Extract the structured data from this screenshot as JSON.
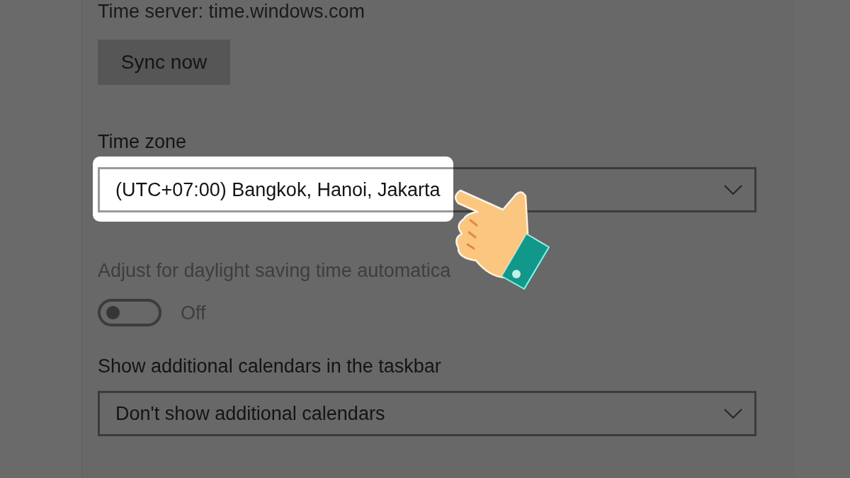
{
  "time_server": {
    "text": "Time server: time.windows.com"
  },
  "sync_button": {
    "label": "Sync now"
  },
  "time_zone": {
    "label": "Time zone",
    "value": "(UTC+07:00) Bangkok, Hanoi, Jakarta",
    "highlighted": true
  },
  "daylight_saving": {
    "label": "Adjust for daylight saving time automatica",
    "disabled": true,
    "on": false,
    "state_text": "Off"
  },
  "additional_calendars": {
    "label": "Show additional calendars in the taskbar",
    "value": "Don't show additional calendars"
  }
}
